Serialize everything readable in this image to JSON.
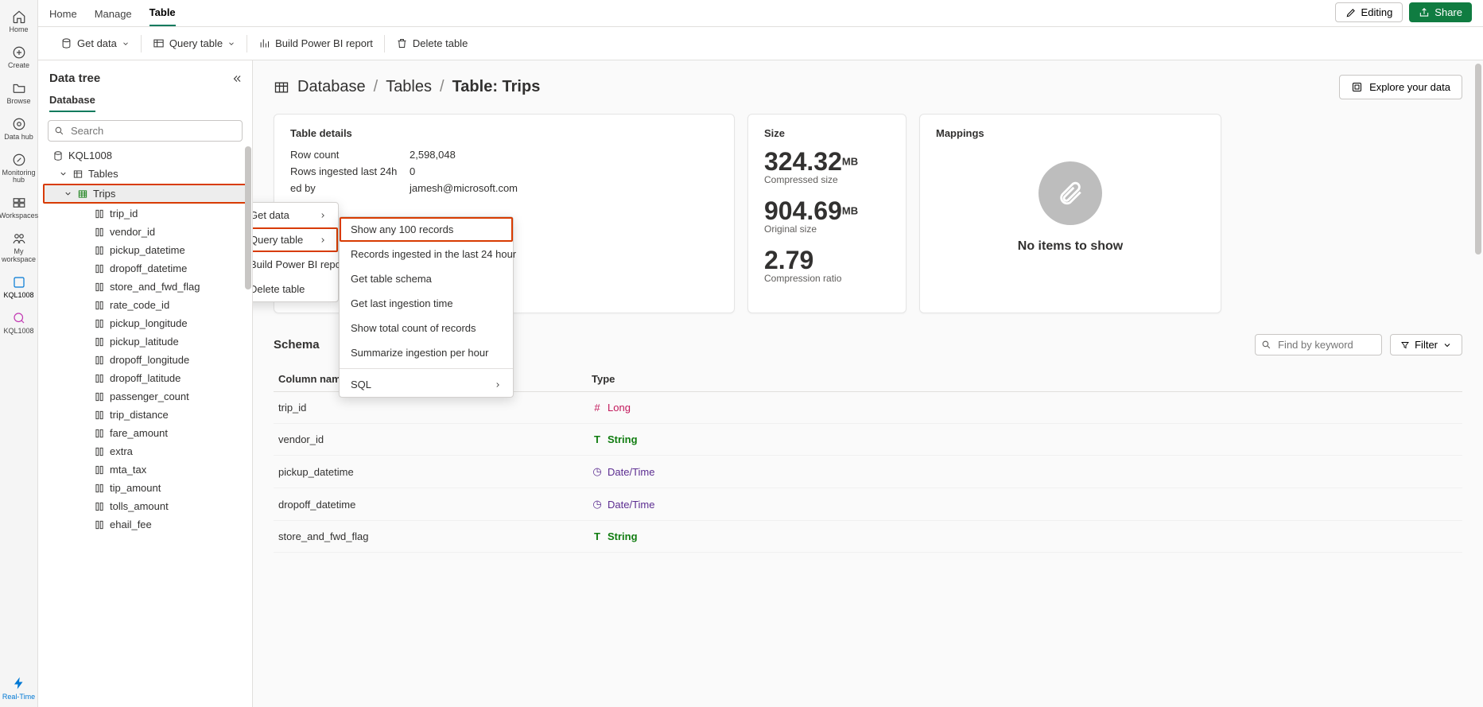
{
  "rail": {
    "items": [
      {
        "label": "Home"
      },
      {
        "label": "Create"
      },
      {
        "label": "Browse"
      },
      {
        "label": "Data hub"
      },
      {
        "label": "Monitoring hub"
      },
      {
        "label": "Workspaces"
      },
      {
        "label": "My workspace"
      },
      {
        "label": "KQL1008"
      },
      {
        "label": "KQL1008"
      }
    ],
    "bottom": "Real-Time"
  },
  "tabs": {
    "items": [
      "Home",
      "Manage",
      "Table"
    ],
    "active": "Table"
  },
  "topright": {
    "editing": "Editing",
    "share": "Share"
  },
  "ribbon": {
    "get_data": "Get data",
    "query_table": "Query table",
    "build_report": "Build Power BI report",
    "delete_table": "Delete table"
  },
  "tree": {
    "title": "Data tree",
    "subtab": "Database",
    "search_placeholder": "Search",
    "db": "KQL1008",
    "tables": "Tables",
    "table": "Trips",
    "columns": [
      "trip_id",
      "vendor_id",
      "pickup_datetime",
      "dropoff_datetime",
      "store_and_fwd_flag",
      "rate_code_id",
      "pickup_longitude",
      "pickup_latitude",
      "dropoff_longitude",
      "dropoff_latitude",
      "passenger_count",
      "trip_distance",
      "fare_amount",
      "extra",
      "mta_tax",
      "tip_amount",
      "tolls_amount",
      "ehail_fee"
    ]
  },
  "breadcrumb": {
    "a": "Database",
    "b": "Tables",
    "c": "Table: Trips"
  },
  "explore": "Explore your data",
  "details": {
    "title": "Table details",
    "row_count_label": "Row count",
    "row_count": "2,598,048",
    "ingested_label": "Rows ingested last 24h",
    "ingested": "0",
    "created_by_label": "ed by",
    "created_by": "jamesh@microsoft.com"
  },
  "size": {
    "title": "Size",
    "compressed_val": "324.32",
    "compressed_unit": "MB",
    "compressed_label": "Compressed size",
    "original_val": "904.69",
    "original_unit": "MB",
    "original_label": "Original size",
    "ratio_val": "2.79",
    "ratio_label": "Compression ratio"
  },
  "mappings": {
    "title": "Mappings",
    "empty": "No items to show"
  },
  "schema": {
    "title": "Schema",
    "find_placeholder": "Find by keyword",
    "filter": "Filter",
    "col_name": "Column name",
    "col_type": "Type",
    "rows": [
      {
        "name": "trip_id",
        "type": "Long",
        "kind": "long"
      },
      {
        "name": "vendor_id",
        "type": "String",
        "kind": "string"
      },
      {
        "name": "pickup_datetime",
        "type": "Date/Time",
        "kind": "dt"
      },
      {
        "name": "dropoff_datetime",
        "type": "Date/Time",
        "kind": "dt"
      },
      {
        "name": "store_and_fwd_flag",
        "type": "String",
        "kind": "string"
      }
    ]
  },
  "ctx1": {
    "get_data": "Get data",
    "query_table": "Query table",
    "build": "Build Power BI report",
    "delete": "Delete table"
  },
  "ctx2": {
    "show_100": "Show any 100 records",
    "records_24": "Records ingested in the last 24 hour",
    "schema": "Get table schema",
    "last_ing": "Get last ingestion time",
    "total": "Show total count of records",
    "summ": "Summarize ingestion per hour",
    "sql": "SQL"
  }
}
